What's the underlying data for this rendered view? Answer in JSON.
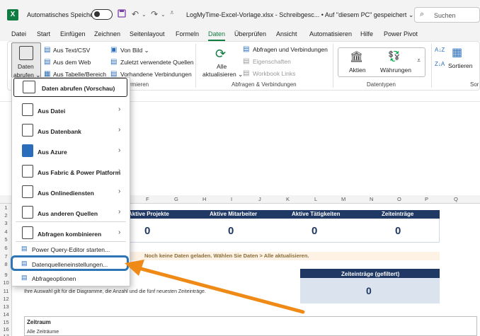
{
  "titlebar": {
    "app_logo": "X",
    "autosave_label": "Automatisches Speichern",
    "autosave_state": "off",
    "doc_title": "LogMyTime-Excel-Vorlage.xlsx  -  Schreibgesc...  •  Auf \"diesem PC\" gespeichert ⌄",
    "search_placeholder": "Suchen",
    "icons": [
      "save-icon",
      "undo-icon",
      "redo-icon",
      "customize-icon",
      "search-icon"
    ]
  },
  "tabs": [
    "Datei",
    "Start",
    "Einfügen",
    "Zeichnen",
    "Seitenlayout",
    "Formeln",
    "Daten",
    "Überprüfen",
    "Ansicht",
    "Automatisieren",
    "Hilfe",
    "Power Pivot"
  ],
  "active_tab": "Daten",
  "ribbon": {
    "get_data": {
      "line1": "Daten",
      "line2": "abrufen ⌄"
    },
    "get_transform": {
      "items": [
        "Aus Text/CSV",
        "Aus dem Web",
        "Aus Tabelle/Bereich",
        "Von Bild ⌄",
        "Zuletzt verwendete Quellen",
        "Vorhandene Verbindungen"
      ],
      "group_label_partial": "rmieren"
    },
    "queries": {
      "refresh_all": {
        "line1": "Alle",
        "line2": "aktualisieren ⌄"
      },
      "items": [
        "Abfragen und Verbindungen",
        "Eigenschaften",
        "Workbook Links"
      ],
      "group_label": "Abfragen & Verbindungen"
    },
    "datatypes": {
      "items": [
        "Aktien",
        "Währungen"
      ],
      "group_label": "Datentypen"
    },
    "sort": {
      "label": "Sortieren",
      "group_label_partial": "Sor"
    }
  },
  "dropdown": {
    "items": [
      {
        "label": "Daten abrufen (Vorschau)",
        "bold": true,
        "submenu": false
      },
      {
        "label": "Aus Datei",
        "bold": true,
        "submenu": true
      },
      {
        "label": "Aus Datenbank",
        "bold": true,
        "submenu": true
      },
      {
        "label": "Aus Azure",
        "bold": true,
        "submenu": true
      },
      {
        "label": "Aus Fabric & Power Platform",
        "bold": true,
        "submenu": true
      },
      {
        "label": "Aus Onlinediensten",
        "bold": true,
        "submenu": true
      },
      {
        "label": "Aus anderen Quellen",
        "bold": true,
        "submenu": true
      },
      {
        "label": "Abfragen kombinieren",
        "bold": true,
        "submenu": true
      },
      {
        "label": "Power Query-Editor starten...",
        "bold": false,
        "submenu": false
      },
      {
        "label": "Datenquelleneinstellungen...",
        "bold": false,
        "submenu": false
      },
      {
        "label": "Abfrageoptionen",
        "bold": false,
        "submenu": false
      }
    ],
    "highlighted": "Datenquelleneinstellungen..."
  },
  "sheet": {
    "columns": [
      "F",
      "G",
      "H",
      "I",
      "J",
      "K",
      "L",
      "M",
      "N",
      "O",
      "P",
      "Q"
    ],
    "rows": [
      "1",
      "2",
      "3",
      "4",
      "5",
      "6",
      "7",
      "8",
      "9",
      "10",
      "11",
      "12",
      "13",
      "14",
      "15",
      "16",
      "17"
    ],
    "kpis": [
      {
        "label": "Aktive Projekte",
        "value": "0"
      },
      {
        "label": "Aktive Mitarbeiter",
        "value": "0"
      },
      {
        "label": "Aktive Tätigkeiten",
        "value": "0"
      },
      {
        "label": "Zeiteinträge",
        "value": "0"
      }
    ],
    "notice": "Noch keine Daten geladen. Wählen Sie Daten > Alle aktualisieren.",
    "filtered": {
      "label": "Zeiteinträge (gefiltert)",
      "value": "0"
    },
    "info": "Ihre Auswahl gilt für die Diagramme, die Anzahl und die fünf neuesten Zeiteinträge.",
    "zeitraum": {
      "label": "Zeitraum",
      "value": "Alle Zeiträume"
    }
  },
  "colors": {
    "excel_green": "#107c41",
    "kpi_navy": "#1f3864",
    "highlight_blue": "#2e75b6",
    "arrow_orange": "#ef8a17",
    "notice_bg": "#fdf2e3"
  }
}
